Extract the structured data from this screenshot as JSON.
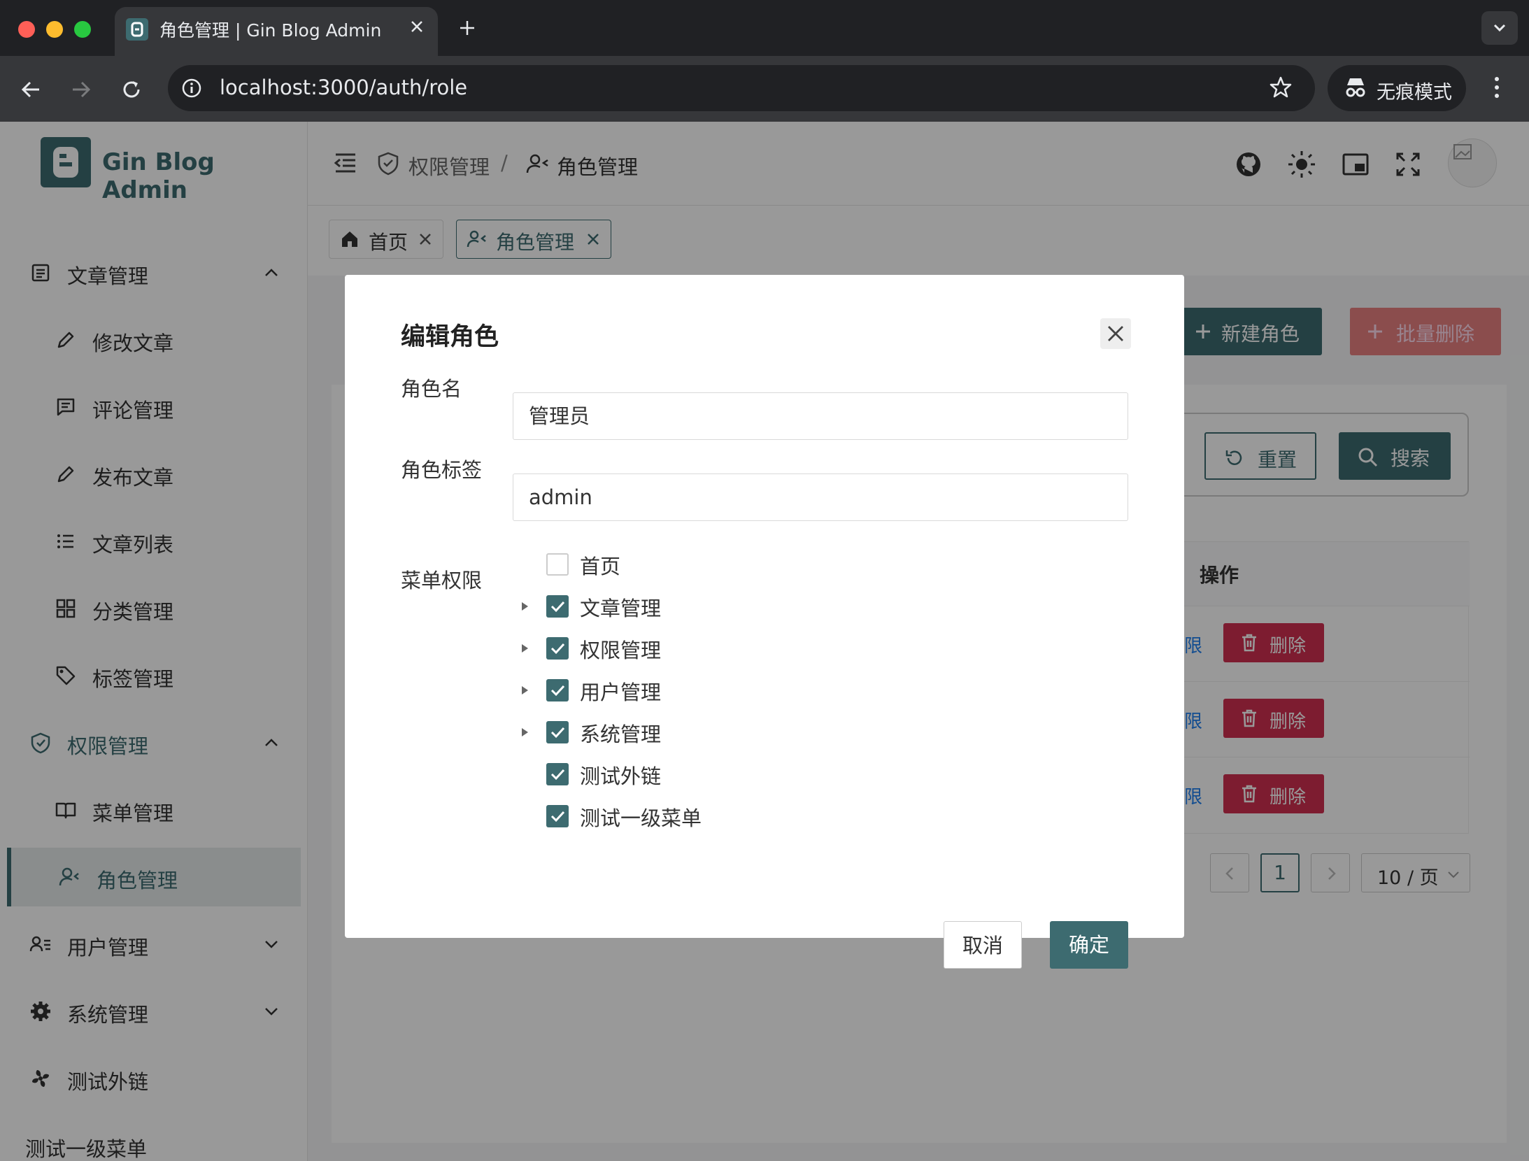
{
  "browser": {
    "tab_title": "角色管理 | Gin Blog Admin",
    "url": "localhost:3000/auth/role",
    "incognito_label": "无痕模式"
  },
  "sidebar": {
    "logo_text": "Gin Blog Admin",
    "items": [
      {
        "label": "文章管理"
      },
      {
        "label": "修改文章"
      },
      {
        "label": "评论管理"
      },
      {
        "label": "发布文章"
      },
      {
        "label": "文章列表"
      },
      {
        "label": "分类管理"
      },
      {
        "label": "标签管理"
      },
      {
        "label": "权限管理"
      },
      {
        "label": "菜单管理"
      },
      {
        "label": "角色管理"
      },
      {
        "label": "用户管理"
      },
      {
        "label": "系统管理"
      },
      {
        "label": "测试外链"
      },
      {
        "label": "测试一级菜单"
      }
    ]
  },
  "header": {
    "breadcrumb": [
      "权限管理",
      "角色管理"
    ],
    "separator": "/"
  },
  "page_tabs": [
    {
      "label": "首页"
    },
    {
      "label": "角色管理"
    }
  ],
  "toolbar": {
    "new_role": "新建角色",
    "batch_delete": "批量删除",
    "reset": "重置",
    "search": "搜索"
  },
  "table": {
    "actions_header": "操作",
    "rows": [
      {
        "link": "单权限",
        "delete": "删除"
      },
      {
        "link": "单权限",
        "delete": "删除"
      },
      {
        "link": "单权限",
        "delete": "删除"
      }
    ]
  },
  "pagination": {
    "current_page": "1",
    "page_size": "10 / 页"
  },
  "modal": {
    "title": "编辑角色",
    "role_name_label": "角色名",
    "role_name_value": "管理员",
    "role_tag_label": "角色标签",
    "role_tag_value": "admin",
    "menu_perm_label": "菜单权限",
    "menu_tree": [
      {
        "label": "首页",
        "checked": false,
        "expandable": false
      },
      {
        "label": "文章管理",
        "checked": true,
        "expandable": true
      },
      {
        "label": "权限管理",
        "checked": true,
        "expandable": true
      },
      {
        "label": "用户管理",
        "checked": true,
        "expandable": true
      },
      {
        "label": "系统管理",
        "checked": true,
        "expandable": true
      },
      {
        "label": "测试外链",
        "checked": true,
        "expandable": false
      },
      {
        "label": "测试一级菜单",
        "checked": true,
        "expandable": false
      }
    ],
    "cancel": "取消",
    "confirm": "确定"
  },
  "colors": {
    "primary": "#3d6b70",
    "danger": "#d03050",
    "link": "#2080f0"
  }
}
